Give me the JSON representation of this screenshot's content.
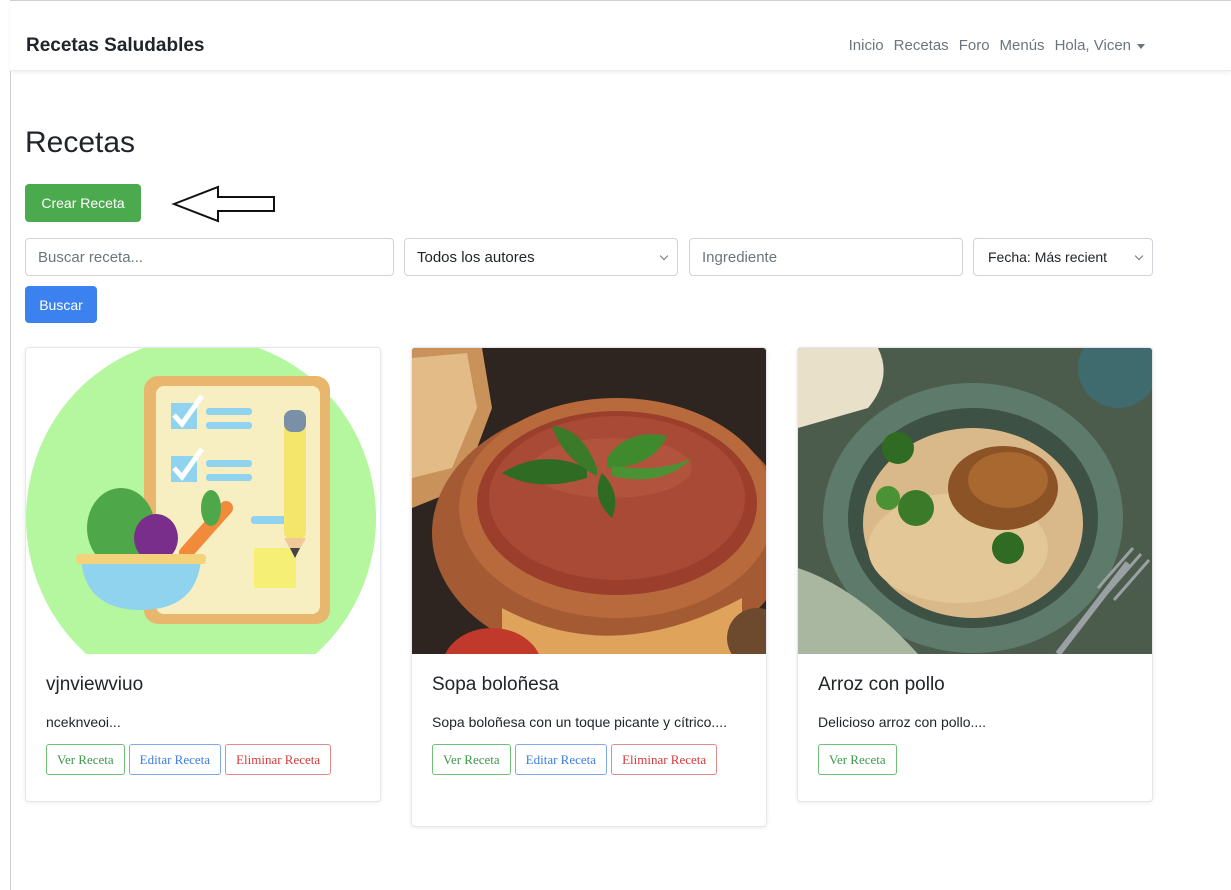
{
  "navbar": {
    "brand": "Recetas Saludables",
    "links": [
      "Inicio",
      "Recetas",
      "Foro",
      "Menús"
    ],
    "user_menu": "Hola, Vicen"
  },
  "page": {
    "title": "Recetas",
    "create_button": "Crear Receta"
  },
  "filters": {
    "search_placeholder": "Buscar receta...",
    "author_select": "Todos los autores",
    "ingredient_placeholder": "Ingrediente",
    "date_select": "Fecha: Más recient",
    "search_button": "Buscar"
  },
  "recipes": [
    {
      "title": "vjnviewviuo",
      "description": "nceknveoi...",
      "view_label": "Ver Receta",
      "edit_label": "Editar Receta",
      "delete_label": "Eliminar Receta"
    },
    {
      "title": "Sopa boloñesa",
      "description": "Sopa boloñesa con un toque picante y cítrico....",
      "view_label": "Ver Receta",
      "edit_label": "Editar Receta",
      "delete_label": "Eliminar Receta"
    },
    {
      "title": "Arroz con pollo",
      "description": "Delicioso arroz con pollo....",
      "view_label": "Ver Receta"
    }
  ],
  "colors": {
    "primary": "#3b82f0",
    "success": "#4caa4e",
    "danger": "#d23b3b"
  }
}
